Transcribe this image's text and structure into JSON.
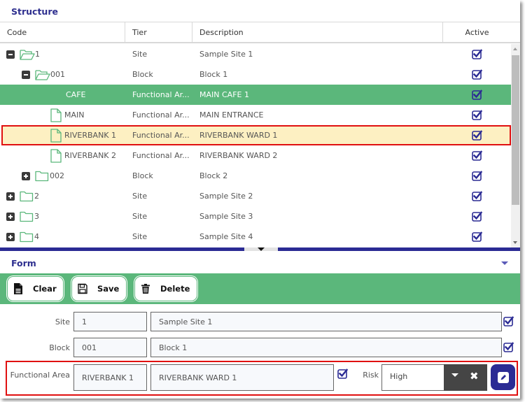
{
  "structure": {
    "title": "Structure",
    "columns": {
      "code": "Code",
      "tier": "Tier",
      "description": "Description",
      "active": "Active"
    },
    "rows": [
      {
        "code": "1",
        "tier": "Site",
        "description": "Sample Site 1",
        "active": true,
        "level": 0,
        "toggle": "collapse",
        "icon": "folder-open-icon",
        "state": "normal"
      },
      {
        "code": "001",
        "tier": "Block",
        "description": "Block 1",
        "active": true,
        "level": 1,
        "toggle": "collapse",
        "icon": "folder-open-icon",
        "state": "normal"
      },
      {
        "code": "CAFE",
        "tier": "Functional Ar...",
        "description": "MAIN CAFE 1",
        "active": true,
        "level": 2,
        "toggle": "none",
        "icon": "none",
        "state": "selected"
      },
      {
        "code": "MAIN",
        "tier": "Functional Ar...",
        "description": "MAIN ENTRANCE",
        "active": true,
        "level": 2,
        "toggle": "none",
        "icon": "file-icon",
        "state": "normal"
      },
      {
        "code": "RIVERBANK 1",
        "tier": "Functional Ar...",
        "description": "RIVERBANK WARD 1",
        "active": true,
        "level": 2,
        "toggle": "none",
        "icon": "file-icon",
        "state": "highlight"
      },
      {
        "code": "RIVERBANK 2",
        "tier": "Functional Ar...",
        "description": "RIVERBANK WARD 2",
        "active": true,
        "level": 2,
        "toggle": "none",
        "icon": "file-icon",
        "state": "normal"
      },
      {
        "code": "002",
        "tier": "Block",
        "description": "Block 2",
        "active": true,
        "level": 1,
        "toggle": "expand",
        "icon": "folder-icon",
        "state": "normal"
      },
      {
        "code": "2",
        "tier": "Site",
        "description": "Sample Site 2",
        "active": true,
        "level": 0,
        "toggle": "expand",
        "icon": "folder-icon",
        "state": "normal"
      },
      {
        "code": "3",
        "tier": "Site",
        "description": "Sample Site 3",
        "active": true,
        "level": 0,
        "toggle": "expand",
        "icon": "folder-icon",
        "state": "normal"
      },
      {
        "code": "4",
        "tier": "Site",
        "description": "Sample Site 4",
        "active": true,
        "level": 0,
        "toggle": "expand",
        "icon": "folder-icon",
        "state": "normal"
      }
    ]
  },
  "form": {
    "title": "Form",
    "toolbar": {
      "clear_label": "Clear",
      "save_label": "Save",
      "delete_label": "Delete"
    },
    "site": {
      "label": "Site",
      "code": "1",
      "description": "Sample Site 1",
      "active": true
    },
    "block": {
      "label": "Block",
      "code": "001",
      "description": "Block 1",
      "active": true
    },
    "functional_area": {
      "label": "Functional Area",
      "code": "RIVERBANK 1",
      "description": "RIVERBANK WARD 1",
      "active": true
    },
    "risk": {
      "label": "Risk",
      "value": "High"
    }
  },
  "colors": {
    "accent_green": "#5bb77b",
    "accent_navy": "#2b2b94",
    "highlight_row": "#fdf0c2",
    "highlight_border": "#e01010"
  }
}
